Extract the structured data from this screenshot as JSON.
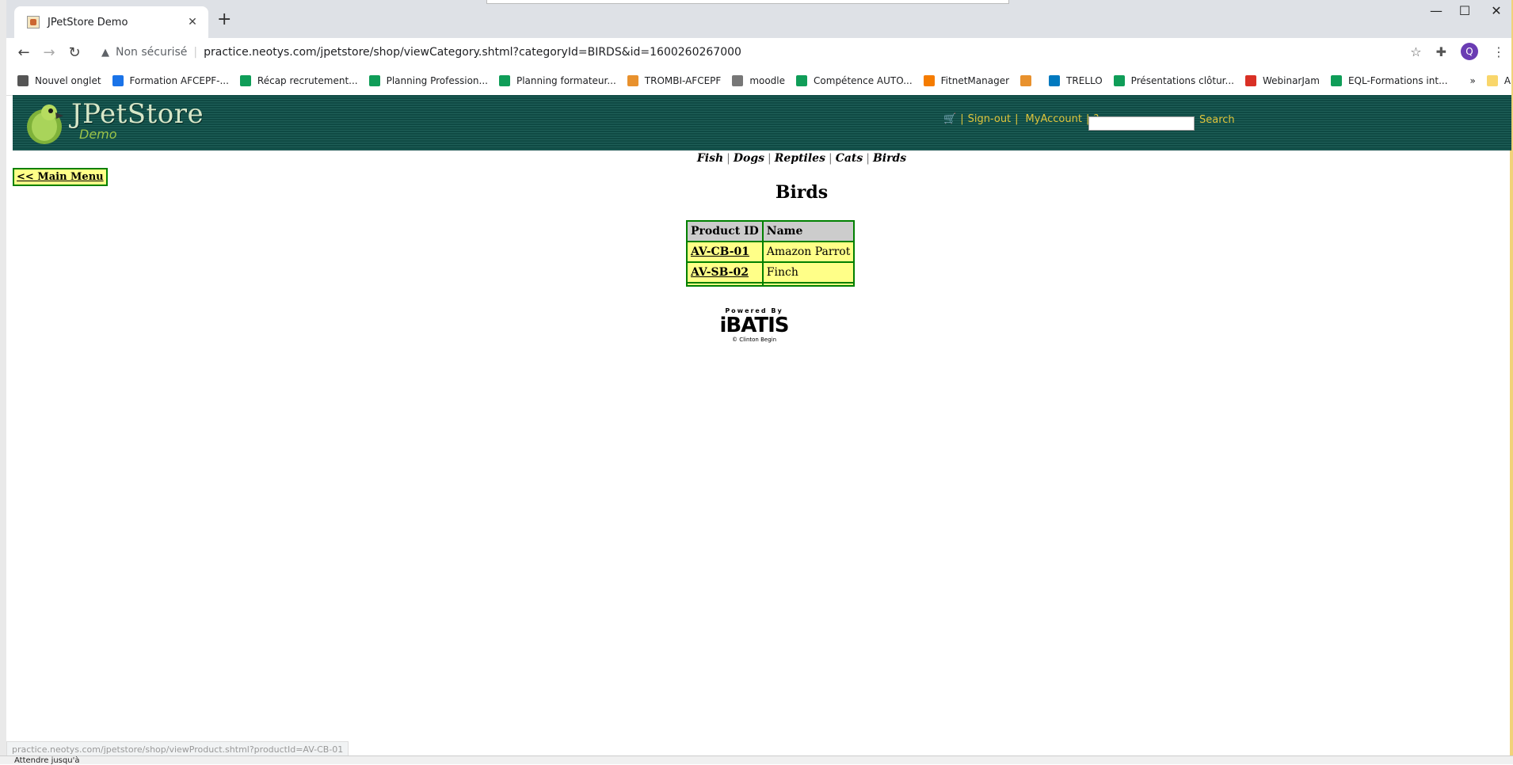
{
  "browser": {
    "tab_title": "JPetStore Demo",
    "new_tab": "+",
    "omnibox_warning": "Non sécurisé",
    "url": "practice.neotys.com/jpetstore/shop/viewCategory.shtml?categoryId=BIRDS&id=1600260267000",
    "profile_initial": "Q"
  },
  "bookmarks": [
    {
      "label": "Nouvel onglet",
      "color": "#555555"
    },
    {
      "label": "Formation AFCEPF-...",
      "color": "#1a73e8"
    },
    {
      "label": "Récap recrutement...",
      "color": "#0f9d58"
    },
    {
      "label": "Planning Profession...",
      "color": "#0f9d58"
    },
    {
      "label": "Planning formateur...",
      "color": "#0f9d58"
    },
    {
      "label": "TROMBI-AFCEPF",
      "color": "#e8912d"
    },
    {
      "label": "moodle",
      "color": "#777777"
    },
    {
      "label": "Compétence AUTO...",
      "color": "#0f9d58"
    },
    {
      "label": "FitnetManager",
      "color": "#f57c00"
    },
    {
      "label": "",
      "color": "#e8912d"
    },
    {
      "label": "TRELLO",
      "color": "#0079bf"
    },
    {
      "label": "Présentations clôtur...",
      "color": "#0f9d58"
    },
    {
      "label": "WebinarJam",
      "color": "#d93025"
    },
    {
      "label": "EQL-Formations int...",
      "color": "#0f9d58"
    }
  ],
  "bookmarks_more": "»",
  "bookmarks_other": "Autres favoris",
  "store": {
    "logo_text": "JPetStore",
    "logo_sub": "Demo",
    "signout": "Sign-out",
    "myaccount": "MyAccount",
    "help": "?",
    "search_btn": "Search",
    "categories": [
      "Fish",
      "Dogs",
      "Reptiles",
      "Cats",
      "Birds"
    ],
    "main_menu": "<< Main Menu",
    "title": "Birds",
    "table": {
      "headers": [
        "Product ID",
        "Name"
      ],
      "rows": [
        {
          "id": "AV-CB-01",
          "name": "Amazon Parrot"
        },
        {
          "id": "AV-SB-02",
          "name": "Finch"
        }
      ]
    },
    "powered_by": "Powered By",
    "ibatis": "iBATIS",
    "ibatis_credit": "© Clinton Begin"
  },
  "status_url": "practice.neotys.com/jpetstore/shop/viewProduct.shtml?productId=AV-CB-01",
  "bottom_text": "Attendre jusqu'à"
}
